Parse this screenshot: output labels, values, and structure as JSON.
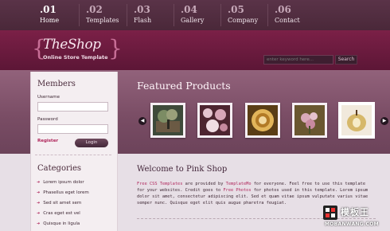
{
  "nav": {
    "items": [
      {
        "num": ".01",
        "label": "Home"
      },
      {
        "num": ".02",
        "label": "Templates"
      },
      {
        "num": ".03",
        "label": "Flash"
      },
      {
        "num": ".04",
        "label": "Gallery"
      },
      {
        "num": ".05",
        "label": "Company"
      },
      {
        "num": ".06",
        "label": "Contact"
      }
    ]
  },
  "header": {
    "logo_title": "TheShop",
    "logo_subtitle": "Online Store Template",
    "brace_left": "{",
    "brace_right": "}",
    "search_placeholder": "enter keyword here...",
    "search_button": "Search"
  },
  "featured": {
    "title": "Featured Products",
    "prev_arrow": "◀",
    "next_arrow": "▶"
  },
  "members": {
    "title": "Members",
    "username_label": "Username",
    "password_label": "Password",
    "register_label": "Register",
    "login_label": "Login"
  },
  "categories": {
    "title": "Categories",
    "bullet": "➜",
    "items": [
      "Lorem ipsum dolor",
      "Phasellus eget lorem",
      "Sed sit amet sem",
      "Cras eget est vel",
      "Quisque in ligula"
    ]
  },
  "content": {
    "title": "Welcome to Pink Shop",
    "p1_a": "Free CSS Templates",
    "p1_b": " are provided by ",
    "p1_c": "TemplateMo",
    "p1_d": " for everyone. Feel free to use this template for your websites. Credit goes to ",
    "p1_e": "Free Photos",
    "p1_f": " for photos used in this template. Lorem ipsum dolor sit amet, consectetur adipiscing elit. Sed et quam vitae ipsum vulputate varius vitae semper nunc. Quisque eget elit quis augue pharetra feugiat."
  },
  "watermark": {
    "text": "模板王",
    "url": "MOBANWANG.COM"
  },
  "colors": {
    "accent": "#b0265b",
    "nav_bg": "#4a2839",
    "header_bg": "#6a1a3f",
    "band_bg": "#7a4d65"
  }
}
